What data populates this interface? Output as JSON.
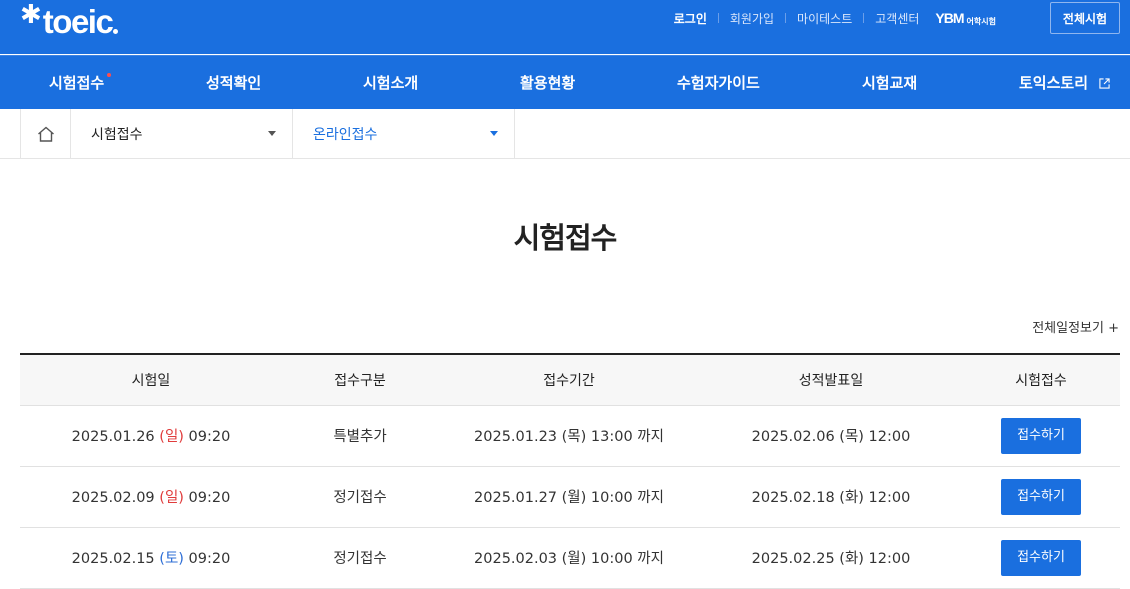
{
  "logo": {
    "text": "toeic"
  },
  "utility": {
    "login": "로그인",
    "signup": "회원가입",
    "mytest": "마이테스트",
    "support": "고객센터",
    "ybm_mark": "YBM",
    "ybm_sub": "어학시험"
  },
  "all_exams_button": "전체시험",
  "gnb": [
    {
      "label": "시험접수"
    },
    {
      "label": "성적확인"
    },
    {
      "label": "시험소개"
    },
    {
      "label": "활용현황"
    },
    {
      "label": "수험자가이드"
    },
    {
      "label": "시험교재"
    },
    {
      "label": "토익스토리"
    }
  ],
  "breadcrumb": {
    "level1": "시험접수",
    "level2": "온라인접수"
  },
  "page_title": "시험접수",
  "view_all_schedule": "전체일정보기 +",
  "table": {
    "headers": [
      "시험일",
      "접수구분",
      "접수기간",
      "성적발표일",
      "시험접수"
    ],
    "rows": [
      {
        "date_a": "2025.01.26 ",
        "day": "(일)",
        "date_b": " 09:20",
        "type": "특별추가",
        "period": "2025.01.23 (목) 13:00 까지",
        "result": "2025.02.06 (목) 12:00",
        "button": "접수하기"
      },
      {
        "date_a": "2025.02.09 ",
        "day": "(일)",
        "date_b": " 09:20",
        "type": "정기접수",
        "period": "2025.01.27 (월) 10:00 까지",
        "result": "2025.02.18 (화) 12:00",
        "button": "접수하기"
      },
      {
        "date_a": "2025.02.15 ",
        "day": "(토)",
        "date_b": " 09:20",
        "type": "정기접수",
        "period": "2025.02.03 (월) 10:00 까지",
        "result": "2025.02.25 (화) 12:00",
        "button": "접수하기"
      }
    ]
  },
  "colors": {
    "brand": "#1a6fdf",
    "sunday": "#e03c3c",
    "saturday": "#2f6fd6"
  }
}
